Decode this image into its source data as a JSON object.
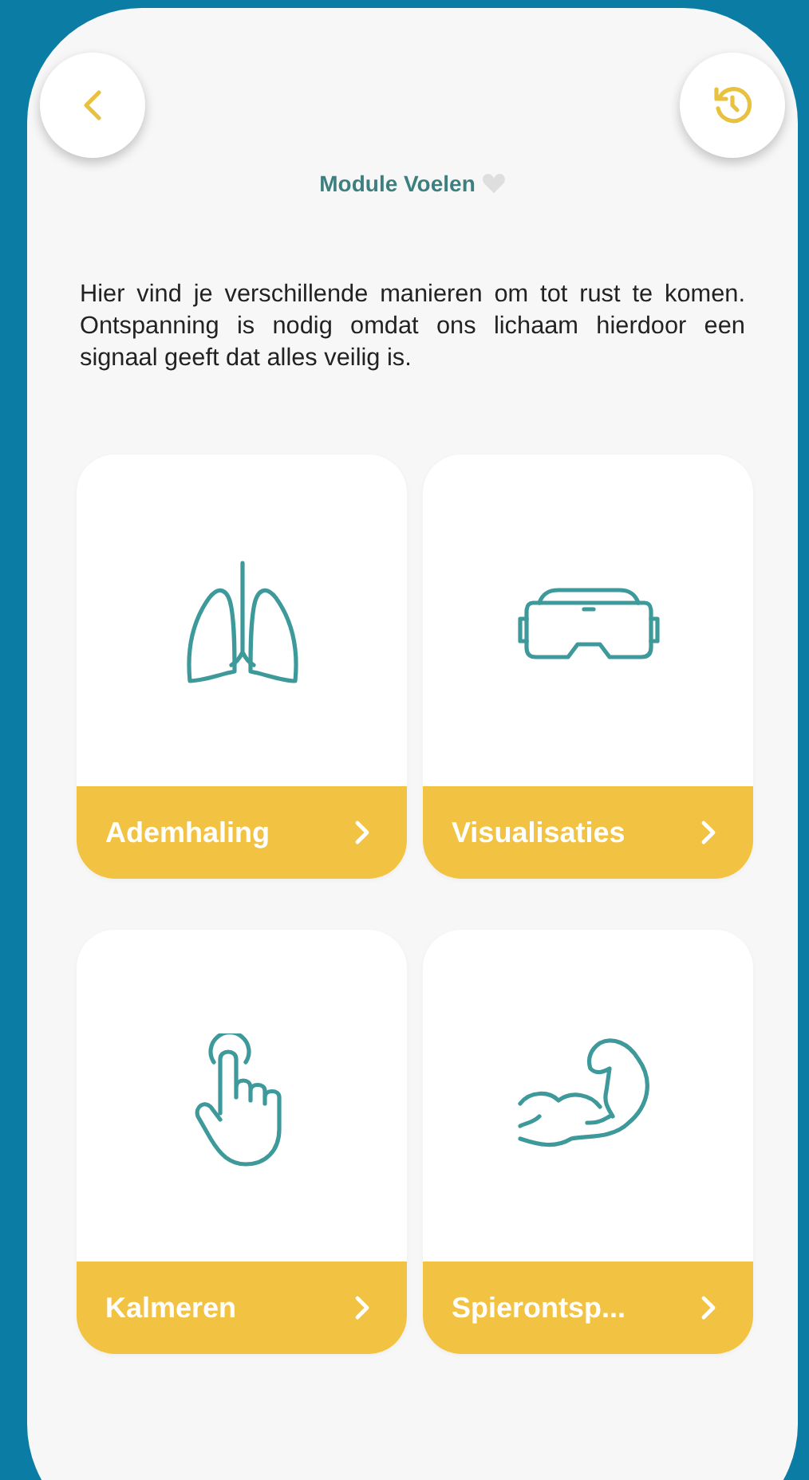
{
  "header": {
    "title": "Module Voelen"
  },
  "intro": "Hier vind je verschillende manieren om tot rust te komen. Ontspanning is nodig omdat ons lichaam hierdoor een signaal geeft dat alles veilig is.",
  "modules": [
    {
      "label": "Ademhaling",
      "kind": "lungs"
    },
    {
      "label": "Visualisaties",
      "kind": "goggles"
    },
    {
      "label": "Kalmeren",
      "kind": "hand"
    },
    {
      "label": "Spierontsp...",
      "kind": "arm"
    }
  ]
}
